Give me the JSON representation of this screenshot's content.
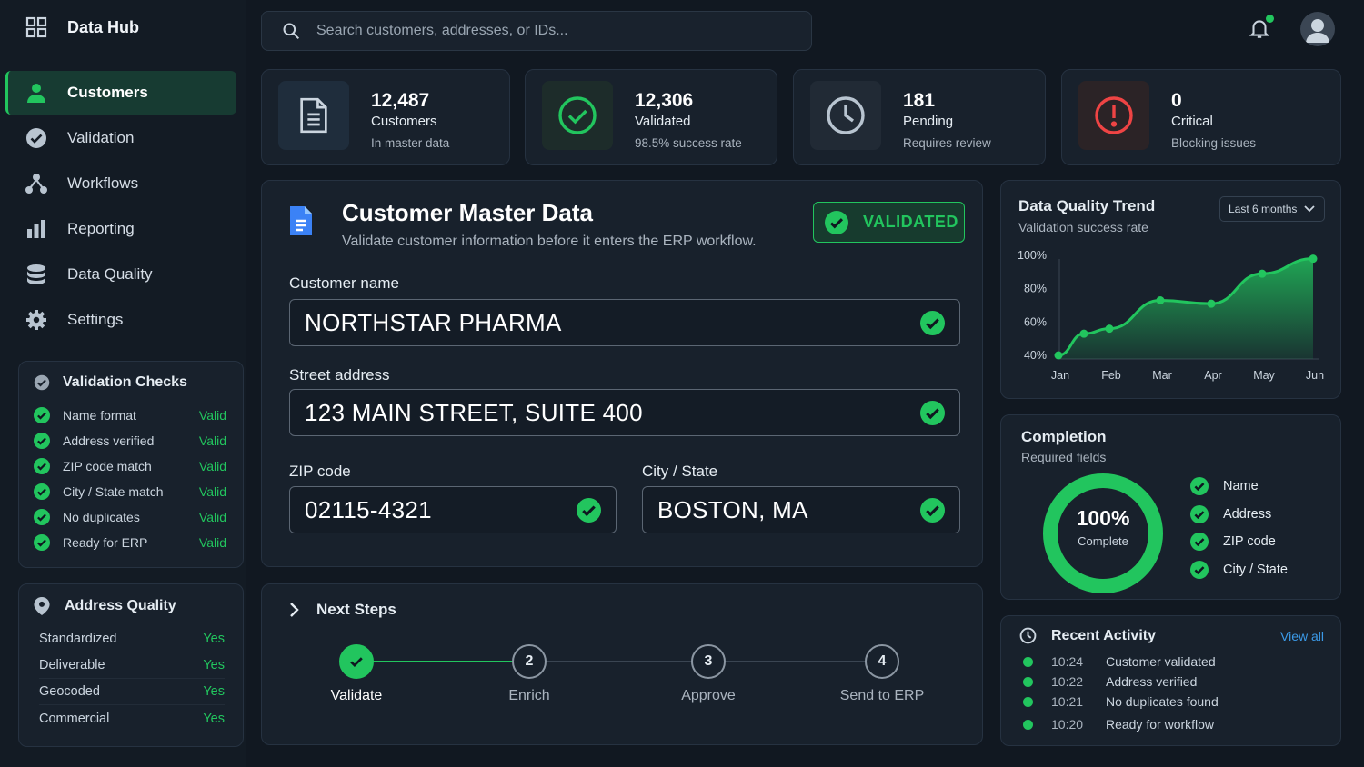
{
  "app": {
    "title": "Data Hub"
  },
  "search": {
    "placeholder": "Search customers, addresses, or IDs..."
  },
  "sidebar": {
    "items": [
      {
        "label": "Customers",
        "icon": "user-icon",
        "active": true
      },
      {
        "label": "Validation",
        "icon": "check-circle-icon"
      },
      {
        "label": "Workflows",
        "icon": "workflow-icon"
      },
      {
        "label": "Reporting",
        "icon": "bar-chart-icon"
      },
      {
        "label": "Data Quality",
        "icon": "database-icon"
      },
      {
        "label": "Settings",
        "icon": "gear-icon"
      }
    ]
  },
  "validation_checks": {
    "title": "Validation Checks",
    "items": [
      {
        "label": "Name format",
        "status": "Valid"
      },
      {
        "label": "Address verified",
        "status": "Valid"
      },
      {
        "label": "ZIP code match",
        "status": "Valid"
      },
      {
        "label": "City / State match",
        "status": "Valid"
      },
      {
        "label": "No duplicates",
        "status": "Valid"
      },
      {
        "label": "Ready for ERP",
        "status": "Valid"
      }
    ]
  },
  "address_quality": {
    "title": "Address Quality",
    "items": [
      {
        "label": "Standardized",
        "value": "Yes"
      },
      {
        "label": "Deliverable",
        "value": "Yes"
      },
      {
        "label": "Geocoded",
        "value": "Yes"
      },
      {
        "label": "Commercial",
        "value": "Yes"
      }
    ]
  },
  "stats": [
    {
      "value": "12,487",
      "label": "Customers",
      "sub": "In master data",
      "icon": "document-icon",
      "color": "#64748b"
    },
    {
      "value": "12,306",
      "label": "Validated",
      "sub": "98.5% success rate",
      "icon": "check-circle-icon",
      "color": "#22c55e"
    },
    {
      "value": "181",
      "label": "Pending",
      "sub": "Requires review",
      "icon": "clock-icon",
      "color": "#94a3b8"
    },
    {
      "value": "0",
      "label": "Critical",
      "sub": "Blocking issues",
      "icon": "alert-icon",
      "color": "#ef4444"
    }
  ],
  "form": {
    "title": "Customer Master Data",
    "subtitle": "Validate customer information before it enters the ERP workflow.",
    "badge": "VALIDATED",
    "fields": {
      "name": {
        "label": "Customer name",
        "value": "NORTHSTAR PHARMA"
      },
      "street": {
        "label": "Street address",
        "value": "123 MAIN STREET, SUITE 400"
      },
      "zip": {
        "label": "ZIP code",
        "value": "02115-4321"
      },
      "city": {
        "label": "City / State",
        "value": "BOSTON, MA"
      }
    }
  },
  "next_steps": {
    "title": "Next Steps",
    "steps": [
      {
        "num": "1",
        "label": "Validate",
        "done": true
      },
      {
        "num": "2",
        "label": "Enrich"
      },
      {
        "num": "3",
        "label": "Approve"
      },
      {
        "num": "4",
        "label": "Send to ERP"
      }
    ]
  },
  "trend": {
    "title": "Data Quality Trend",
    "subtitle": "Validation success rate",
    "range": "Last 6 months"
  },
  "chart_data": {
    "type": "area",
    "title": "Data Quality Trend",
    "subtitle": "Validation success rate",
    "x": [
      "Jan",
      "Feb",
      "Mar",
      "Apr",
      "May",
      "Jun"
    ],
    "points": [
      {
        "x": "Jan",
        "y": 40
      },
      {
        "x": "Jan–Feb",
        "y": 53
      },
      {
        "x": "Feb",
        "y": 56
      },
      {
        "x": "Mar",
        "y": 73
      },
      {
        "x": "Apr",
        "y": 71
      },
      {
        "x": "May",
        "y": 89
      },
      {
        "x": "Jun",
        "y": 98
      }
    ],
    "yticks": [
      "100%",
      "80%",
      "60%",
      "40%"
    ],
    "ylim": [
      40,
      100
    ],
    "color": "#22c55e",
    "grid": false,
    "legend": "none"
  },
  "completion": {
    "title": "Completion",
    "subtitle": "Required fields",
    "percent_label": "100%",
    "percent_value": 1.0,
    "caption": "Complete",
    "items": [
      "Name",
      "Address",
      "ZIP code",
      "City / State"
    ]
  },
  "activity": {
    "title": "Recent Activity",
    "view_all": "View all",
    "items": [
      {
        "time": "10:24",
        "text": "Customer validated"
      },
      {
        "time": "10:22",
        "text": "Address verified"
      },
      {
        "time": "10:21",
        "text": "No duplicates found"
      },
      {
        "time": "10:20",
        "text": "Ready for workflow"
      }
    ]
  },
  "colors": {
    "accent": "#22c55e",
    "background": "#111821",
    "panel": "#18212c",
    "link": "#3b9ae8",
    "critical": "#ef4444"
  }
}
